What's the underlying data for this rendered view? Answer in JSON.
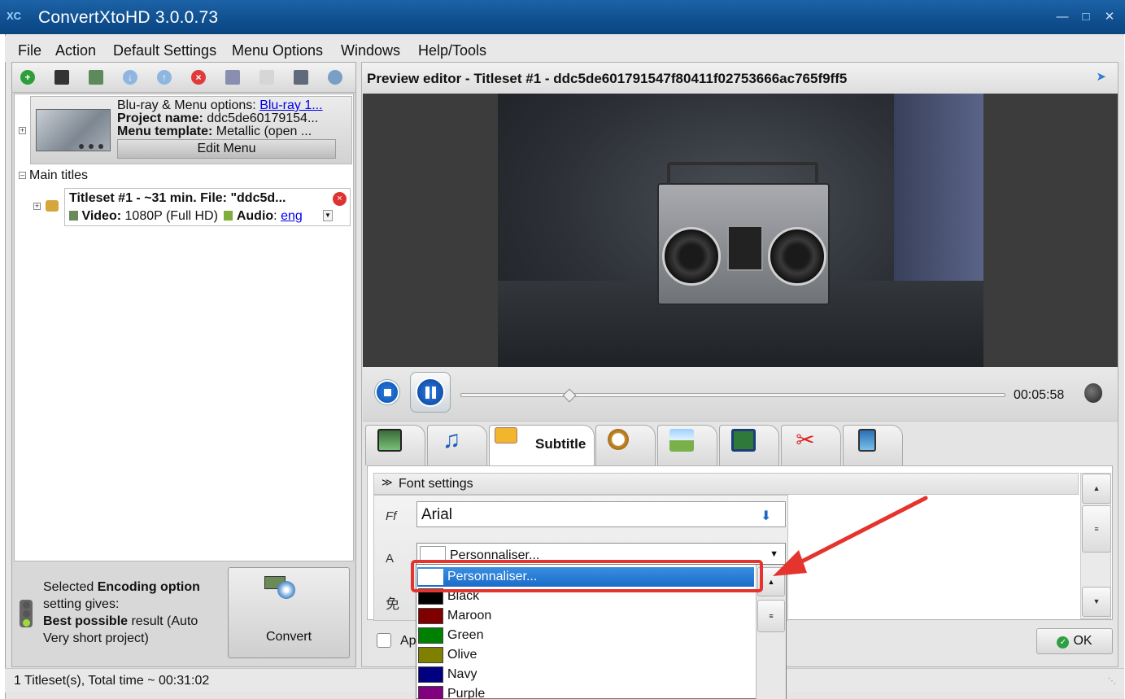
{
  "window": {
    "title": "ConvertXtoHD 3.0.0.73"
  },
  "menu": [
    "File",
    "Action",
    "Default Settings",
    "Menu Options",
    "Windows",
    "Help/Tools"
  ],
  "project": {
    "options_label": "Blu-ray & Menu options:",
    "options_value": "Blu-ray 1...",
    "name_label": "Project name:",
    "name_value": "ddc5de60179154...",
    "template_label": "Menu template:",
    "template_value": "Metallic (open ...",
    "edit_menu_label": "Edit Menu"
  },
  "tree": {
    "main_titles": "Main titles",
    "titleset_line": "Titleset #1 - ~31 min. File: \"ddc5d...",
    "video_label": "Video:",
    "video_value": "1080P (Full HD)",
    "audio_label": "Audio",
    "audio_value": "eng"
  },
  "encoding": {
    "line1_pre": "Selected ",
    "line1_bold": "Encoding option",
    "line2": "setting gives:",
    "line3_bold": "Best possible",
    "line3_rest": " result (Auto",
    "line4": "Very short project)"
  },
  "convert_label": "Convert",
  "status_text": "1 Titleset(s), Total time ~ 00:31:02",
  "preview": {
    "header": "Preview editor - Titleset #1 - ddc5de601791547f80411f02753666ac765f9ff5",
    "time": "00:05:58",
    "progress": 0.19
  },
  "tabs": {
    "subtitle_label": "Subtitle"
  },
  "font_settings": {
    "section_label": "Font settings",
    "font_value": "Arial",
    "color_value": "Personnaliser..."
  },
  "apply_label": "Ap",
  "ok_label": "OK",
  "dropdown": {
    "items": [
      {
        "name": "Personnaliser...",
        "color": "#ffffff"
      },
      {
        "name": "Black",
        "color": "#000000"
      },
      {
        "name": "Maroon",
        "color": "#800000"
      },
      {
        "name": "Green",
        "color": "#008000"
      },
      {
        "name": "Olive",
        "color": "#808000"
      },
      {
        "name": "Navy",
        "color": "#000080"
      },
      {
        "name": "Purple",
        "color": "#800080"
      }
    ]
  },
  "colors": {
    "accent": "#1a6cc8",
    "annotation": "#e5332d"
  }
}
